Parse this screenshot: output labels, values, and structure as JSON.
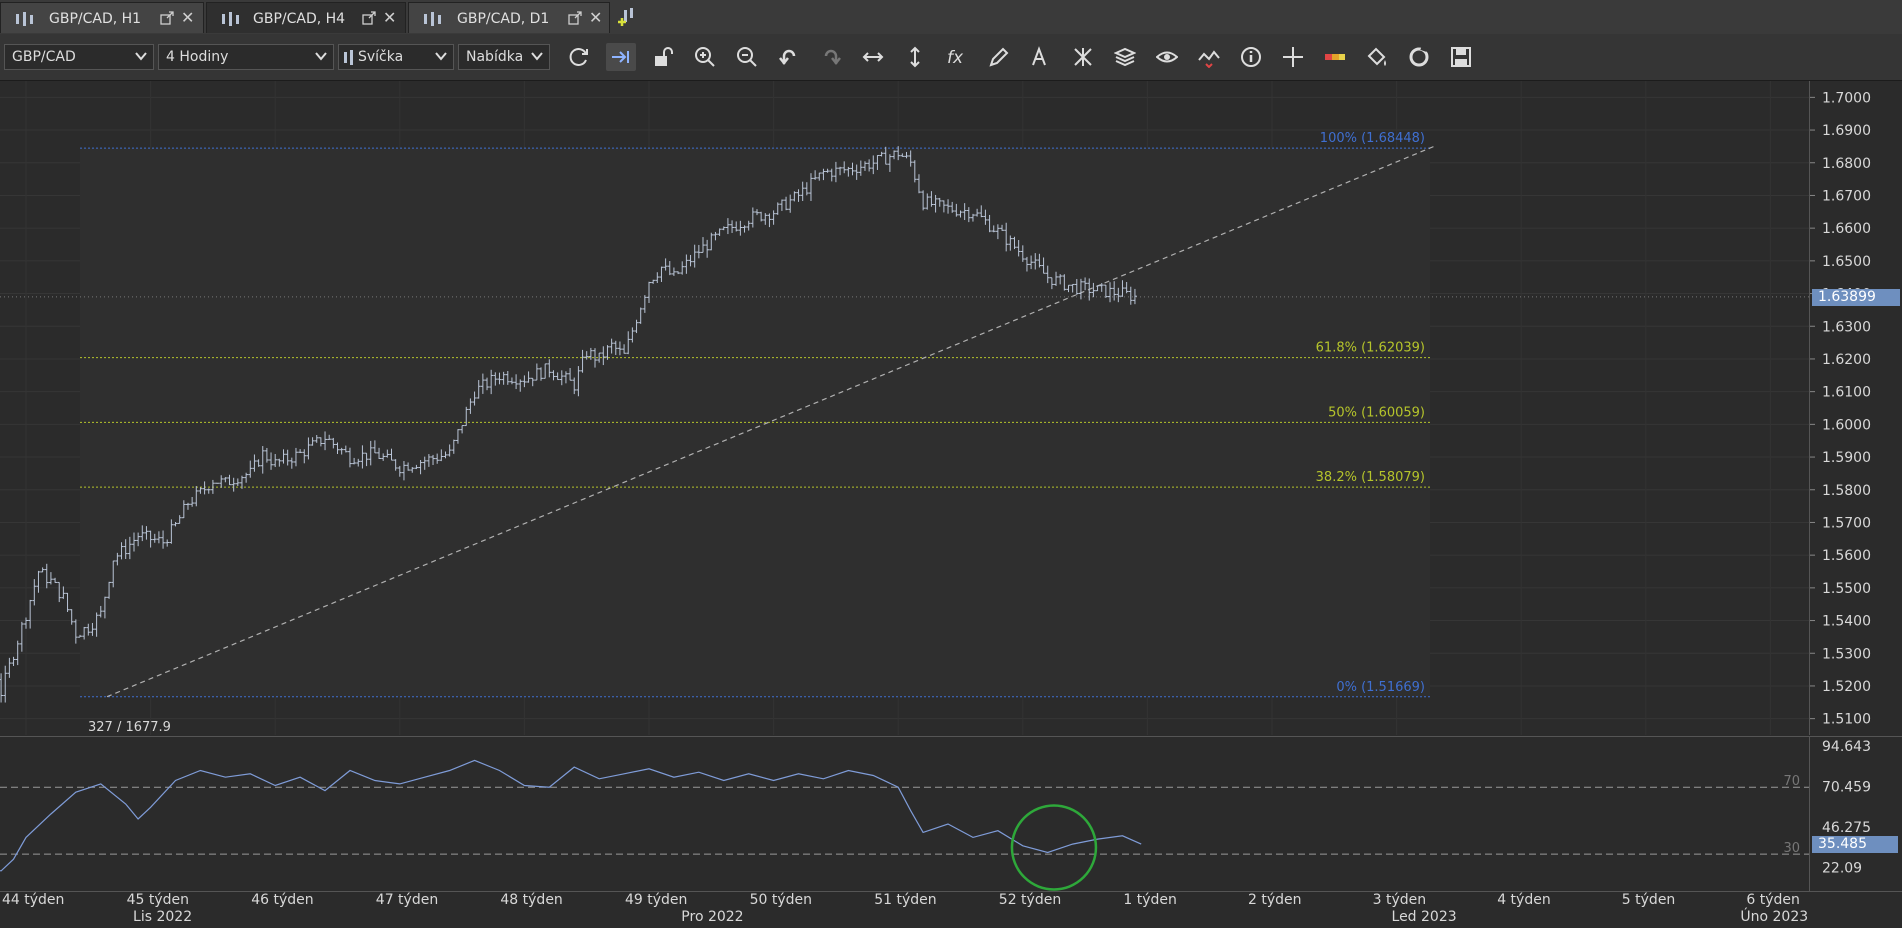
{
  "tabs": [
    {
      "label": "GBP/CAD, H1",
      "active": false
    },
    {
      "label": "GBP/CAD, H4",
      "active": true
    },
    {
      "label": "GBP/CAD, D1",
      "active": false
    }
  ],
  "toolbar": {
    "symbol": "GBP/CAD",
    "timeframe": "4 Hodiny",
    "chart_type": "Svíčka",
    "price_side": "Nabídka",
    "icons": [
      "refresh-icon",
      "auto-scroll-icon",
      "unlock-icon",
      "zoom-in-icon",
      "zoom-out-icon",
      "undo-icon",
      "redo-icon",
      "horizontal-scale-icon",
      "vertical-scale-icon",
      "function-icon",
      "pencil-icon",
      "text-tool-icon",
      "pattern-icon",
      "layers-icon",
      "eye-icon",
      "indicator-icon",
      "info-icon",
      "crosshair-icon",
      "color-bar-icon",
      "paint-bucket-icon",
      "sync-icon",
      "save-icon"
    ]
  },
  "colors": {
    "bg": "#2b2b2b",
    "candle": "#b9c4d6",
    "fib_top": "#3f6fd0",
    "fib_mid": "#b5c42b",
    "trend": "#b0b0b0",
    "rsi": "#7f9cd8",
    "highlight_circle": "#2ea83a",
    "price_tag": "#6e8fbf"
  },
  "chart_data": {
    "type": "candlestick",
    "symbol": "GBP/CAD",
    "timeframe": "H4",
    "y_axis": {
      "min": 1.505,
      "max": 1.705,
      "ticks": [
        "1.7000",
        "1.6900",
        "1.6800",
        "1.6700",
        "1.6600",
        "1.6500",
        "1.6400",
        "1.6300",
        "1.6200",
        "1.6100",
        "1.6000",
        "1.5900",
        "1.5800",
        "1.5700",
        "1.5600",
        "1.5500",
        "1.5400",
        "1.5300",
        "1.5200",
        "1.5100"
      ]
    },
    "current_price": "1.63899",
    "fib_levels": [
      {
        "label": "100% (1.68448)",
        "value": 1.68448
      },
      {
        "label": "61.8% (1.62039)",
        "value": 1.62039
      },
      {
        "label": "50% (1.60059)",
        "value": 1.60059
      },
      {
        "label": "38.2% (1.58079)",
        "value": 1.58079
      },
      {
        "label": "0% (1.51669)",
        "value": 1.51669
      }
    ],
    "cursor_readout": "327 / 1677.9",
    "trendline": {
      "from": {
        "week": 44.65,
        "price": 1.5167
      },
      "to": {
        "week": 55.3,
        "price": 1.685
      }
    },
    "price_path": [
      [
        43.0,
        1.566
      ],
      [
        43.2,
        1.565
      ],
      [
        43.4,
        1.564
      ],
      [
        43.45,
        1.56
      ],
      [
        43.5,
        1.544
      ],
      [
        43.6,
        1.536
      ],
      [
        43.7,
        1.533
      ],
      [
        43.8,
        1.518
      ],
      [
        43.9,
        1.53
      ],
      [
        44.0,
        1.542
      ],
      [
        44.1,
        1.555
      ],
      [
        44.2,
        1.552
      ],
      [
        44.3,
        1.547
      ],
      [
        44.4,
        1.536
      ],
      [
        44.5,
        1.538
      ],
      [
        44.6,
        1.542
      ],
      [
        44.7,
        1.559
      ],
      [
        44.8,
        1.562
      ],
      [
        44.9,
        1.566
      ],
      [
        45.0,
        1.565
      ],
      [
        45.1,
        1.564
      ],
      [
        45.2,
        1.569
      ],
      [
        45.3,
        1.576
      ],
      [
        45.4,
        1.579
      ],
      [
        45.5,
        1.583
      ],
      [
        45.6,
        1.582
      ],
      [
        45.7,
        1.584
      ],
      [
        45.8,
        1.585
      ],
      [
        45.9,
        1.591
      ],
      [
        46.0,
        1.588
      ],
      [
        46.2,
        1.591
      ],
      [
        46.4,
        1.596
      ],
      [
        46.6,
        1.59
      ],
      [
        46.8,
        1.591
      ],
      [
        47.0,
        1.587
      ],
      [
        47.2,
        1.589
      ],
      [
        47.4,
        1.591
      ],
      [
        47.6,
        1.61
      ],
      [
        47.8,
        1.615
      ],
      [
        48.0,
        1.614
      ],
      [
        48.2,
        1.617
      ],
      [
        48.4,
        1.612
      ],
      [
        48.5,
        1.622
      ],
      [
        48.6,
        1.62
      ],
      [
        48.7,
        1.624
      ],
      [
        48.8,
        1.621
      ],
      [
        49.0,
        1.644
      ],
      [
        49.1,
        1.648
      ],
      [
        49.2,
        1.645
      ],
      [
        49.4,
        1.653
      ],
      [
        49.6,
        1.659
      ],
      [
        49.8,
        1.663
      ],
      [
        50.0,
        1.665
      ],
      [
        50.2,
        1.67
      ],
      [
        50.4,
        1.677
      ],
      [
        50.6,
        1.678
      ],
      [
        50.8,
        1.68
      ],
      [
        51.0,
        1.683
      ],
      [
        51.1,
        1.68
      ],
      [
        51.2,
        1.668
      ],
      [
        51.4,
        1.666
      ],
      [
        51.6,
        1.665
      ],
      [
        51.8,
        1.659
      ],
      [
        52.0,
        1.652
      ],
      [
        52.2,
        1.645
      ],
      [
        52.4,
        1.642
      ],
      [
        52.6,
        1.641
      ],
      [
        52.8,
        1.64
      ],
      [
        52.9,
        1.639
      ]
    ],
    "time_axis": {
      "weeks": [
        {
          "label": "44 týden",
          "week": 44
        },
        {
          "label": "45 týden",
          "week": 45
        },
        {
          "label": "46 týden",
          "week": 46
        },
        {
          "label": "47 týden",
          "week": 47
        },
        {
          "label": "48 týden",
          "week": 48
        },
        {
          "label": "49 týden",
          "week": 49
        },
        {
          "label": "50 týden",
          "week": 50
        },
        {
          "label": "51 týden",
          "week": 51
        },
        {
          "label": "52 týden",
          "week": 52
        },
        {
          "label": "1 týden",
          "week": 53
        },
        {
          "label": "2 týden",
          "week": 54
        },
        {
          "label": "3 týden",
          "week": 55
        },
        {
          "label": "4 týden",
          "week": 56
        },
        {
          "label": "5 týden",
          "week": 57
        },
        {
          "label": "6 týden",
          "week": 58
        }
      ],
      "months": [
        {
          "label": "Lis 2022",
          "week": 45.1
        },
        {
          "label": "Pro 2022",
          "week": 49.5
        },
        {
          "label": "Led 2023",
          "week": 55.2
        },
        {
          "label": "Úno 2023",
          "week": 58.0
        }
      ]
    },
    "indicator": {
      "name": "RSI",
      "axis_ticks": [
        "94.643",
        "70.459",
        "46.275",
        "22.09"
      ],
      "levels": [
        {
          "label": "70",
          "value": 70
        },
        {
          "label": "30",
          "value": 30
        }
      ],
      "current_value": "35.485",
      "series": [
        [
          43.0,
          44
        ],
        [
          43.3,
          43
        ],
        [
          43.5,
          30
        ],
        [
          43.6,
          23
        ],
        [
          43.8,
          20
        ],
        [
          43.9,
          27
        ],
        [
          44.0,
          40
        ],
        [
          44.2,
          54
        ],
        [
          44.4,
          67
        ],
        [
          44.6,
          72
        ],
        [
          44.8,
          60
        ],
        [
          44.9,
          51
        ],
        [
          45.0,
          58
        ],
        [
          45.2,
          74
        ],
        [
          45.4,
          80
        ],
        [
          45.6,
          76
        ],
        [
          45.8,
          78
        ],
        [
          46.0,
          71
        ],
        [
          46.2,
          76
        ],
        [
          46.4,
          68
        ],
        [
          46.6,
          80
        ],
        [
          46.8,
          74
        ],
        [
          47.0,
          72
        ],
        [
          47.2,
          76
        ],
        [
          47.4,
          80
        ],
        [
          47.6,
          86
        ],
        [
          47.8,
          80
        ],
        [
          48.0,
          71
        ],
        [
          48.2,
          70
        ],
        [
          48.4,
          82
        ],
        [
          48.6,
          75
        ],
        [
          48.8,
          78
        ],
        [
          49.0,
          81
        ],
        [
          49.2,
          76
        ],
        [
          49.4,
          79
        ],
        [
          49.6,
          74
        ],
        [
          49.8,
          78
        ],
        [
          50.0,
          74
        ],
        [
          50.2,
          78
        ],
        [
          50.4,
          75
        ],
        [
          50.6,
          80
        ],
        [
          50.8,
          77
        ],
        [
          51.0,
          70
        ],
        [
          51.1,
          56
        ],
        [
          51.2,
          43
        ],
        [
          51.4,
          48
        ],
        [
          51.6,
          40
        ],
        [
          51.8,
          44
        ],
        [
          52.0,
          35
        ],
        [
          52.2,
          31
        ],
        [
          52.4,
          36
        ],
        [
          52.6,
          39
        ],
        [
          52.8,
          41
        ],
        [
          52.95,
          36
        ]
      ]
    }
  }
}
